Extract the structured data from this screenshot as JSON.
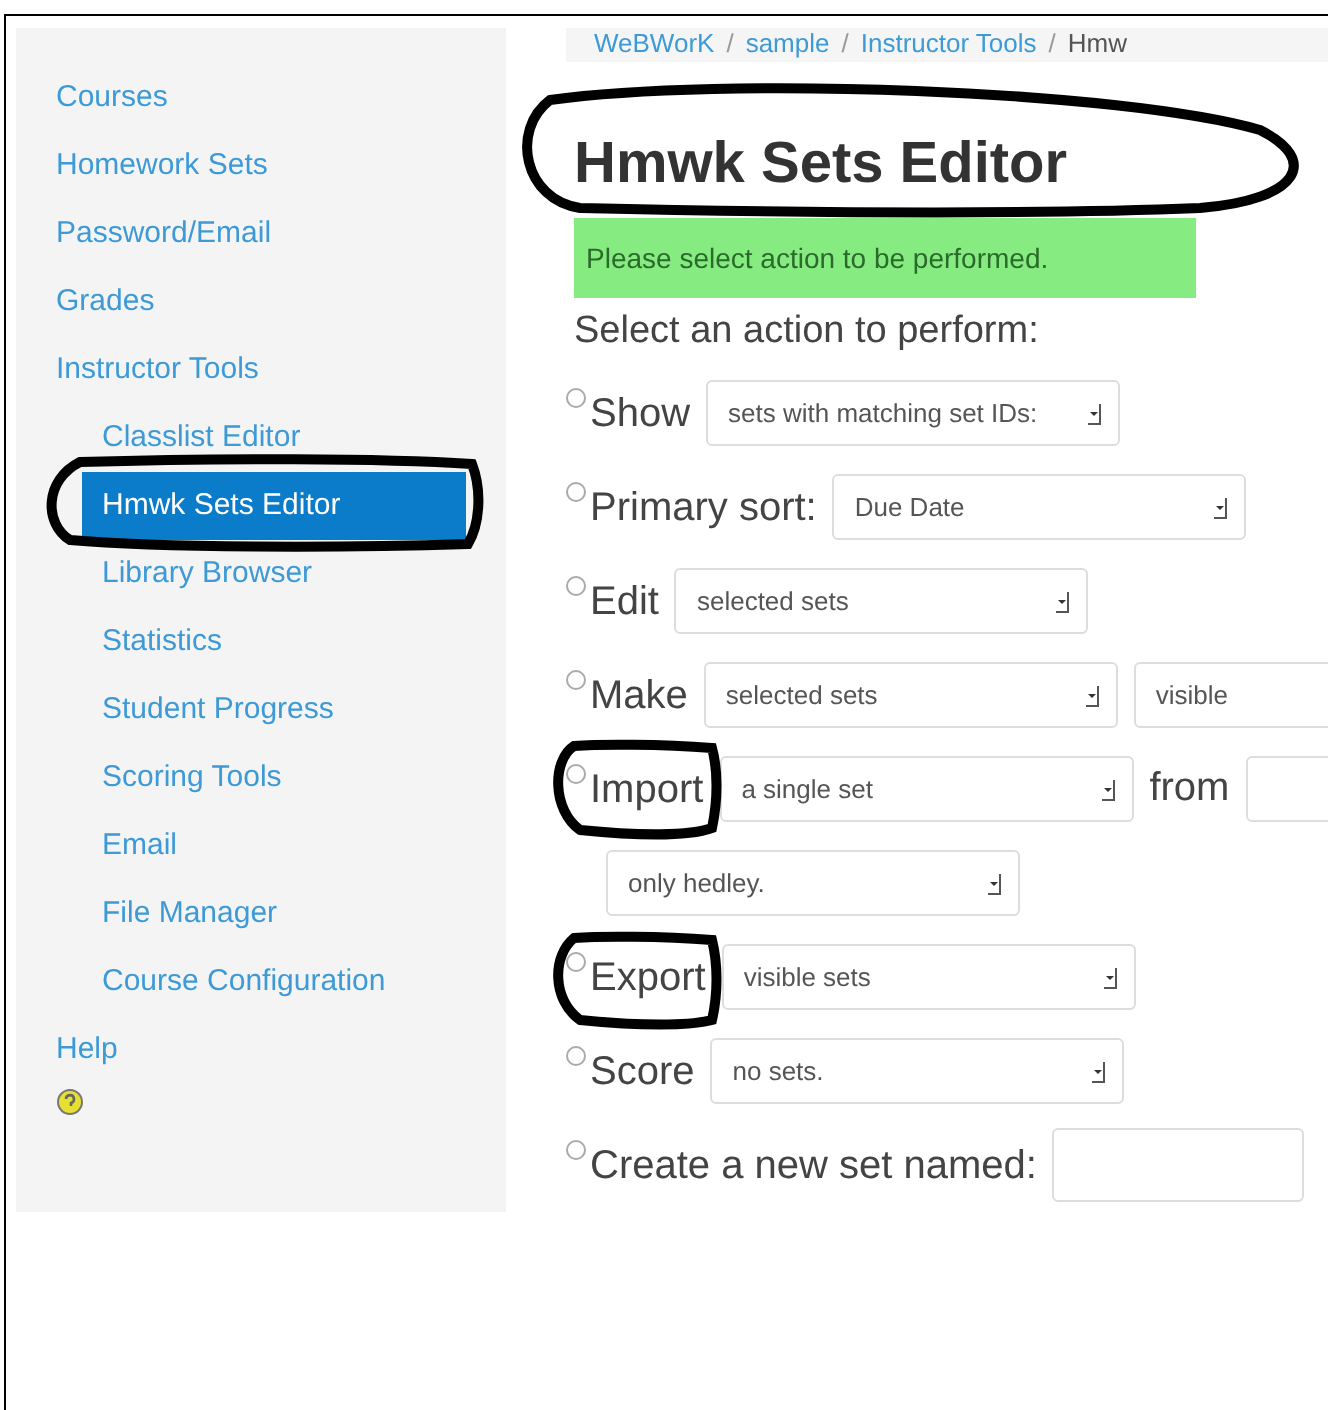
{
  "sidebar": {
    "items": [
      {
        "label": "Courses",
        "selected": false
      },
      {
        "label": "Homework Sets",
        "selected": false
      },
      {
        "label": "Password/Email",
        "selected": false
      },
      {
        "label": "Grades",
        "selected": false
      },
      {
        "label": "Instructor Tools",
        "selected": false,
        "children": [
          {
            "label": "Classlist Editor",
            "selected": false
          },
          {
            "label": "Hmwk Sets Editor",
            "selected": true
          },
          {
            "label": "Library Browser",
            "selected": false
          },
          {
            "label": "Statistics",
            "selected": false
          },
          {
            "label": "Student Progress",
            "selected": false
          },
          {
            "label": "Scoring Tools",
            "selected": false
          },
          {
            "label": "Email",
            "selected": false
          },
          {
            "label": "File Manager",
            "selected": false
          },
          {
            "label": "Course Configuration",
            "selected": false
          }
        ]
      },
      {
        "label": "Help",
        "selected": false
      }
    ]
  },
  "breadcrumb": {
    "separator": "/",
    "items": [
      "WeBWorK",
      "sample",
      "Instructor Tools",
      "Hmw"
    ]
  },
  "title": "Hmwk Sets Editor",
  "message": "Please select action to be performed.",
  "prompt": "Select an action to perform:",
  "actions": [
    {
      "label": "Show",
      "selected": false,
      "controls": [
        {
          "kind": "select",
          "value": "sets with matching set IDs:"
        }
      ]
    },
    {
      "label": "Primary sort:",
      "selected": false,
      "controls": [
        {
          "kind": "select",
          "value": "Due Date"
        }
      ]
    },
    {
      "label": "Edit",
      "selected": false,
      "controls": [
        {
          "kind": "select",
          "value": "selected sets"
        }
      ]
    },
    {
      "label": "Make",
      "selected": false,
      "controls": [
        {
          "kind": "select",
          "value": "selected sets"
        },
        {
          "kind": "select",
          "value": "visible"
        }
      ]
    },
    {
      "label": "Import",
      "selected": false,
      "controls": [
        {
          "kind": "select",
          "value": "a single set"
        },
        {
          "kind": "text",
          "text": "from"
        },
        {
          "kind": "select"
        }
      ],
      "extra": [
        {
          "kind": "select",
          "value": "only hedley."
        }
      ]
    },
    {
      "label": "Export",
      "selected": false,
      "controls": [
        {
          "kind": "select",
          "value": "visible sets"
        }
      ]
    },
    {
      "label": "Score",
      "selected": false,
      "controls": [
        {
          "kind": "select",
          "value": "no sets."
        }
      ]
    },
    {
      "label": "Create a new set named:",
      "selected": false,
      "controls": [
        {
          "kind": "input"
        }
      ]
    }
  ]
}
